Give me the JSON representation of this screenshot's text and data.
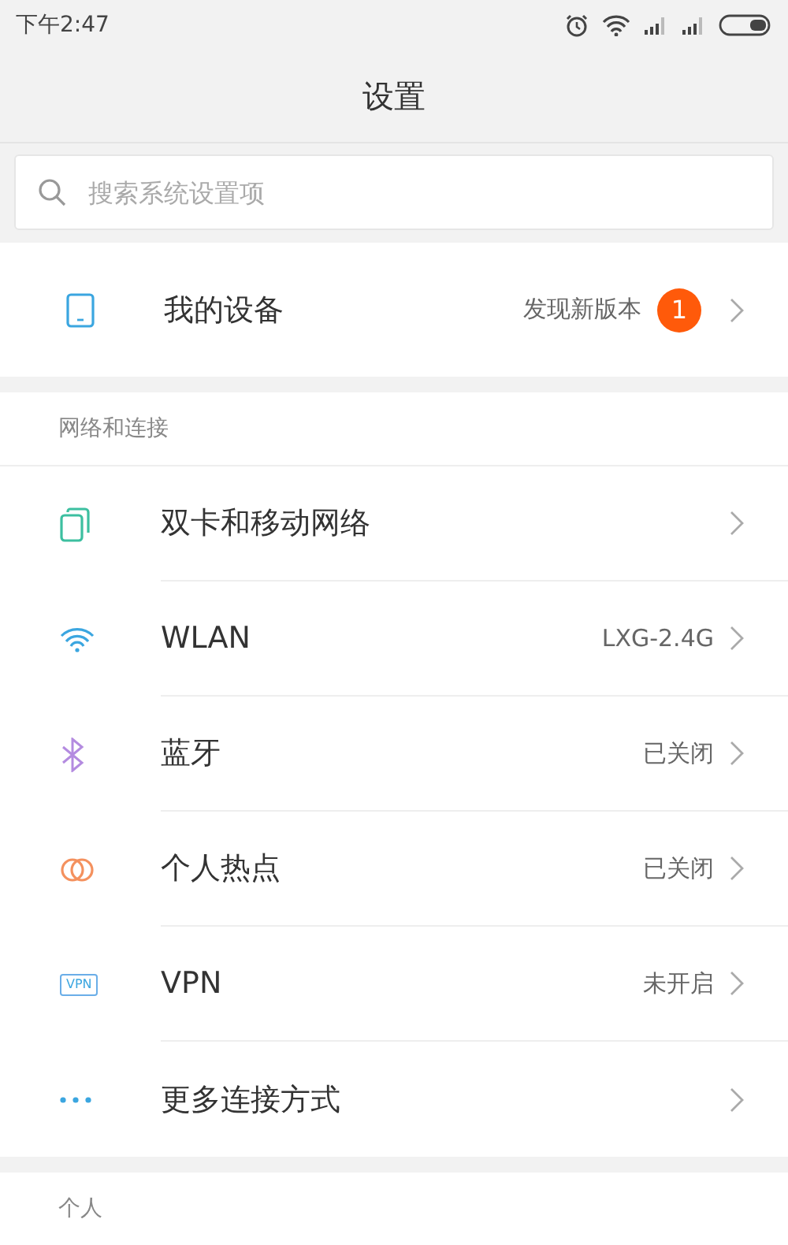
{
  "status_bar": {
    "time": "下午2:47"
  },
  "title": "设置",
  "search": {
    "placeholder": "搜索系统设置项"
  },
  "device": {
    "label": "我的设备",
    "value": "发现新版本",
    "badge": "1"
  },
  "sections": [
    {
      "title": "网络和连接",
      "items": [
        {
          "kind": "sim",
          "label": "双卡和移动网络"
        },
        {
          "kind": "wifi",
          "label": "WLAN",
          "value": "LXG-2.4G"
        },
        {
          "kind": "bluetooth",
          "label": "蓝牙",
          "value": "已关闭"
        },
        {
          "kind": "hotspot",
          "label": "个人热点",
          "value": "已关闭"
        },
        {
          "kind": "vpn",
          "label": "VPN",
          "value": "未开启",
          "icon_text": "VPN"
        },
        {
          "kind": "more",
          "label": "更多连接方式"
        }
      ]
    },
    {
      "title": "个人"
    }
  ]
}
